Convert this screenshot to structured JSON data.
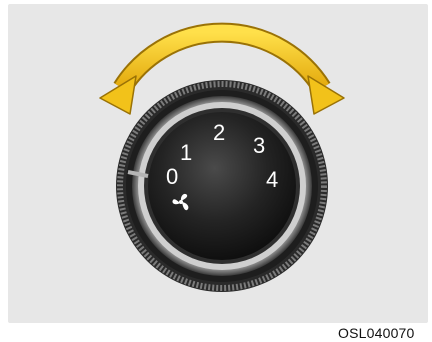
{
  "dial": {
    "positions": [
      "0",
      "1",
      "2",
      "3",
      "4"
    ]
  },
  "caption": "OSL040070",
  "colors": {
    "background": "#e7e7e7",
    "arrow": "#f2c21a",
    "knob": "#1b1b1b",
    "bezel": "#8a8a8a"
  },
  "icons": {
    "fan": "fan-icon",
    "arrow": "double-headed-curved-arrow-icon"
  }
}
